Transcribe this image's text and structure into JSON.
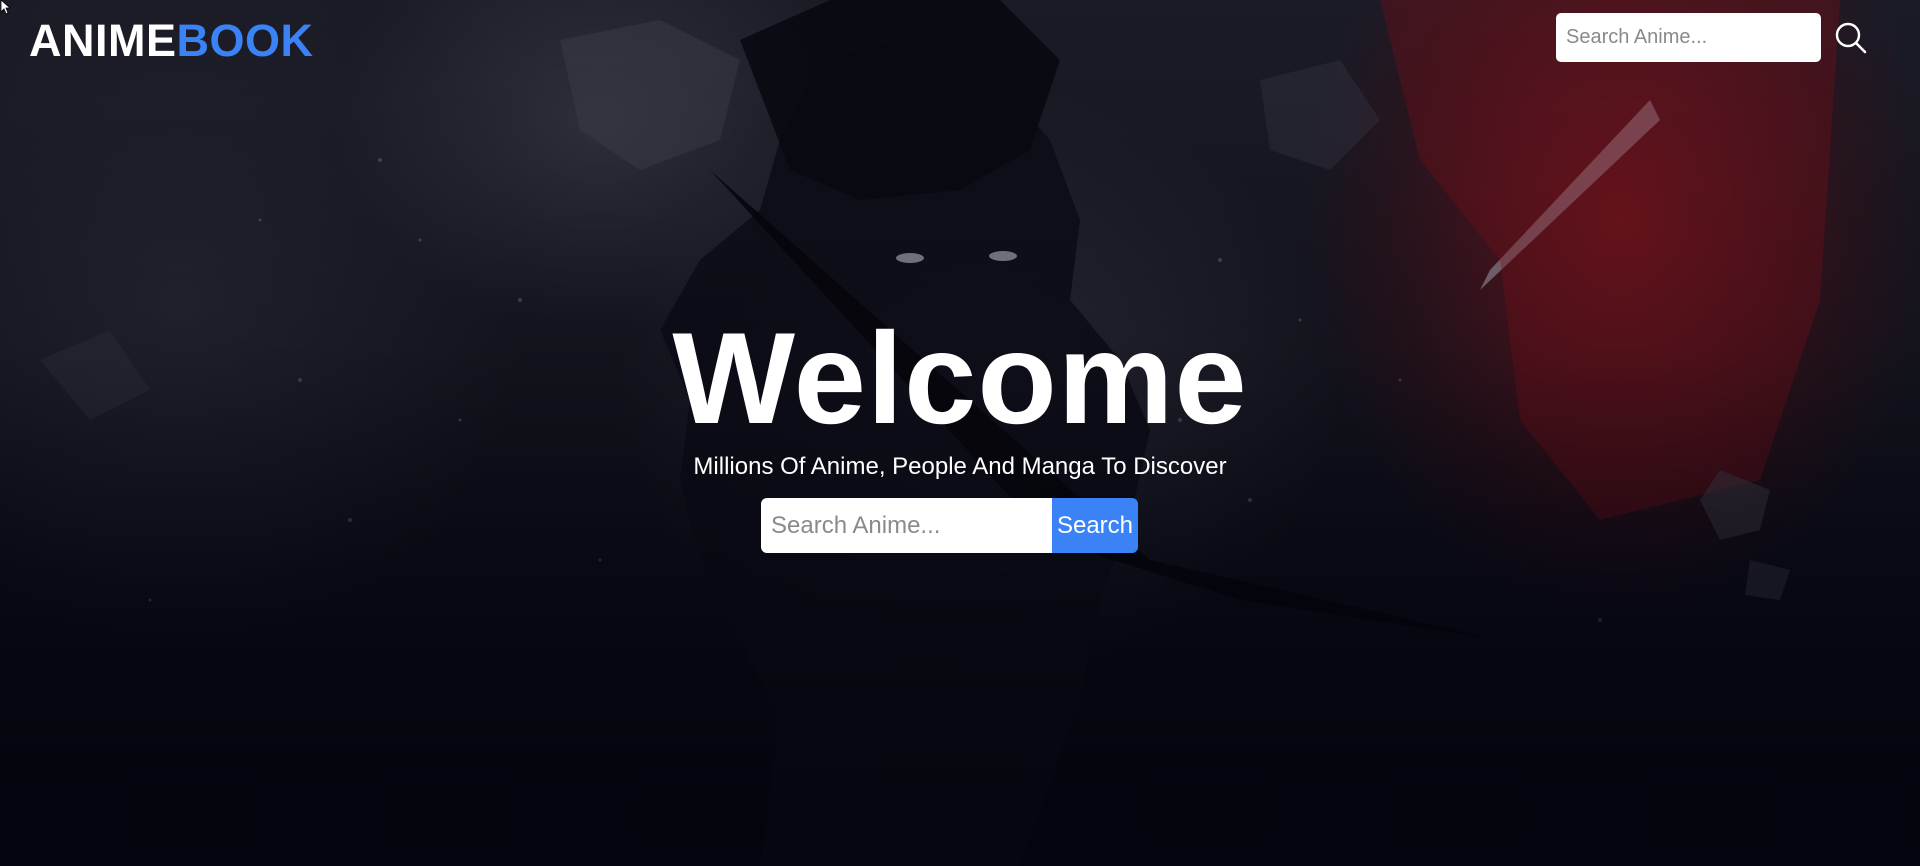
{
  "header": {
    "logo_part1": "ANIME",
    "logo_part2": "BOOK",
    "search_placeholder": "Search Anime...",
    "search_icon": "search-icon"
  },
  "hero": {
    "title": "Welcome",
    "subtitle": "Millions Of Anime, People And Manga To Discover",
    "search_placeholder": "Search Anime...",
    "search_button": "Search"
  },
  "colors": {
    "accent": "#3b82f6",
    "background": "#0b0b16",
    "text": "#ffffff"
  }
}
